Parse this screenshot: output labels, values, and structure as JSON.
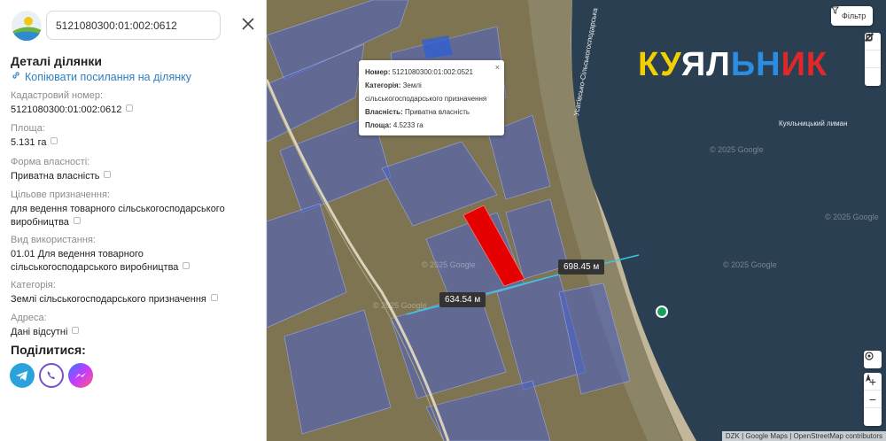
{
  "search": {
    "value": "5121080300:01:002:0612"
  },
  "details": {
    "heading": "Деталі ділянки",
    "copy_link": "Копіювати посилання на ділянку",
    "fields": [
      {
        "label": "Кадастровий номер:",
        "value": "5121080300:01:002:0612"
      },
      {
        "label": "Площа:",
        "value": "5.131 га"
      },
      {
        "label": "Форма власності:",
        "value": "Приватна власність"
      },
      {
        "label": "Цільове призначення:",
        "value": "для ведення товарного сільськогосподарського виробництва"
      },
      {
        "label": "Вид використання:",
        "value": "01.01 Для ведення товарного сільськогосподарського виробництва"
      },
      {
        "label": "Категорія:",
        "value": "Землі сільськогосподарського призначення"
      },
      {
        "label": "Адреса:",
        "value": "Дані відсутні"
      }
    ]
  },
  "share": {
    "heading": "Поділитися:",
    "items": [
      "telegram-icon",
      "viber-icon",
      "messenger-icon"
    ]
  },
  "popup": {
    "number_label": "Номер:",
    "number": "5121080300:01:002:0521",
    "category_label": "Категорія:",
    "category": "Землі сільськогосподарського призначення",
    "ownership_label": "Власність:",
    "ownership": "Приватна власність",
    "area_label": "Площа:",
    "area": "4.5233 га"
  },
  "measurements": [
    "698.45 м",
    "634.54 м"
  ],
  "brand": {
    "letters": [
      "К",
      "У",
      "Я",
      "Л",
      "Ь",
      "Н",
      "И",
      "К"
    ],
    "colors": [
      "#f2d000",
      "#f2d000",
      "#ffffff",
      "#ffffff",
      "#2b8de0",
      "#2b8de0",
      "#e0282a",
      "#e0282a"
    ]
  },
  "map": {
    "place_label": "Куяльницький лиман",
    "road_label": "Усатівсько-Сільськогосподарська",
    "watermarks": [
      "© 2025 Google",
      "© 2025 Google",
      "© 2025 Google",
      "© 2025 Google",
      "© 2025 Google"
    ],
    "filter_label": "Фільтр",
    "attribution": "DZK | Google Maps | OpenStreetMap contributors"
  },
  "colors": {
    "link": "#2f7fc1",
    "highlight": "#e50000",
    "parcel": "#4a63c9"
  }
}
